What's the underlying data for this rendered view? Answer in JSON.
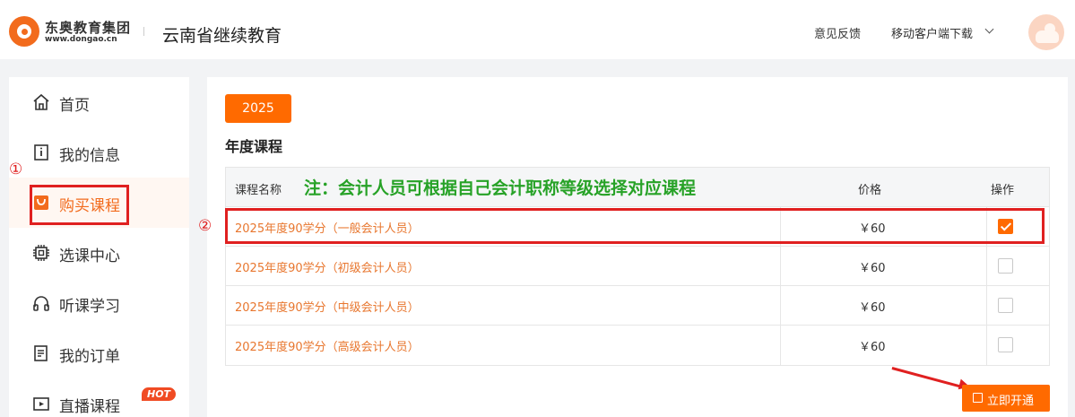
{
  "header": {
    "logo_name": "东奥教育集团",
    "logo_url": "www.dongao.cn",
    "site_title": "云南省继续教育",
    "feedback": "意见反馈",
    "mobile_download": "移动客户端下载"
  },
  "sidebar": {
    "items": [
      {
        "label": "首页",
        "icon": "home-icon"
      },
      {
        "label": "我的信息",
        "icon": "info-icon"
      },
      {
        "label": "购买课程",
        "icon": "shopping-bag-icon",
        "active": true
      },
      {
        "label": "选课中心",
        "icon": "chip-icon"
      },
      {
        "label": "听课学习",
        "icon": "headphones-icon"
      },
      {
        "label": "我的订单",
        "icon": "order-icon"
      },
      {
        "label": "直播课程",
        "icon": "live-icon",
        "badge": "HOT"
      }
    ]
  },
  "main": {
    "year_tab": "2025",
    "section_title": "年度课程",
    "table": {
      "headers": {
        "name": "课程名称",
        "price": "价格",
        "action": "操作"
      },
      "note": "注：会计人员可根据自己会计职称等级选择对应课程",
      "rows": [
        {
          "name": "2025年度90学分（一般会计人员）",
          "price": "￥60",
          "checked": true
        },
        {
          "name": "2025年度90学分（初级会计人员）",
          "price": "￥60",
          "checked": false
        },
        {
          "name": "2025年度90学分（中级会计人员）",
          "price": "￥60",
          "checked": false
        },
        {
          "name": "2025年度90学分（高级会计人员）",
          "price": "￥60",
          "checked": false
        }
      ]
    },
    "buy_button": "立即开通"
  },
  "annotations": {
    "marker1": "①",
    "marker2": "②"
  },
  "colors": {
    "accent": "#ff6a00",
    "annotation": "#e02020",
    "note": "#27a227"
  }
}
